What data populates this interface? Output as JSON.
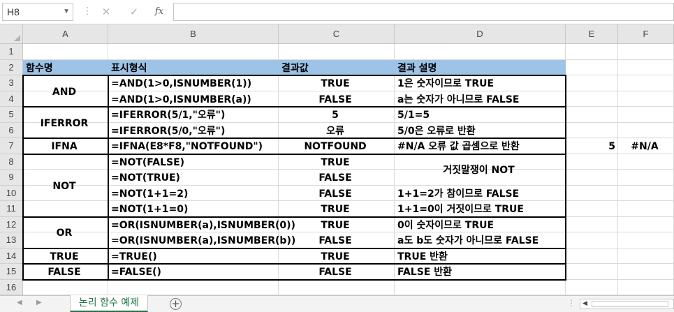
{
  "formula_bar": {
    "name_box": "H8",
    "name_box_dropdown_icon": "chevron-down-icon",
    "more_icon": "vertical-dots-icon",
    "cancel_icon": "close-icon",
    "enter_icon": "checkmark-icon",
    "function_icon": "fx-icon",
    "fx_label": "fx",
    "formula": ""
  },
  "columns": [
    "A",
    "B",
    "C",
    "D",
    "E",
    "F"
  ],
  "rows": [
    "1",
    "2",
    "3",
    "4",
    "5",
    "6",
    "7",
    "8",
    "9",
    "10",
    "11",
    "12",
    "13",
    "14",
    "15",
    "16"
  ],
  "header_row": {
    "a": "함수명",
    "b": "표시형식",
    "c": "결과값",
    "d": "결과 설명"
  },
  "table": [
    {
      "func": "AND",
      "rows": [
        {
          "formula": "=AND(1>0,ISNUMBER(1))",
          "result": "TRUE",
          "desc": "1은 숫자이므로 TRUE"
        },
        {
          "formula": "=AND(1>0,ISNUMBER(a))",
          "result": "FALSE",
          "desc": "a는 숫자가 아니므로 FALSE"
        }
      ]
    },
    {
      "func": "IFERROR",
      "rows": [
        {
          "formula": "=IFERROR(5/1,\"오류\")",
          "result": "5",
          "desc": "5/1=5"
        },
        {
          "formula": "=IFERROR(5/0,\"오류\")",
          "result": "오류",
          "desc": "5/0은 오류로 반환"
        }
      ]
    },
    {
      "func": "IFNA",
      "rows": [
        {
          "formula": "=IFNA(E8*F8,\"NOTFOUND\")",
          "result": "NOTFOUND",
          "desc": "#N/A 오류 값 곱셈으로 반환"
        }
      ]
    },
    {
      "func": "NOT",
      "merged_desc": "거짓말쟁이 NOT",
      "rows": [
        {
          "formula": "=NOT(FALSE)",
          "result": "TRUE",
          "desc": ""
        },
        {
          "formula": "=NOT(TRUE)",
          "result": "FALSE",
          "desc": ""
        },
        {
          "formula": "=NOT(1+1=2)",
          "result": "FALSE",
          "desc": "1+1=2가 참이므로 FALSE"
        },
        {
          "formula": "=NOT(1+1=0)",
          "result": "TRUE",
          "desc": "1+1=0이 거짓이므로 TRUE"
        }
      ]
    },
    {
      "func": "OR",
      "rows": [
        {
          "formula": "=OR(ISNUMBER(a),ISNUMBER(0))",
          "result": "TRUE",
          "desc": "0이 숫자이므로 TRUE"
        },
        {
          "formula": "=OR(ISNUMBER(a),ISNUMBER(b))",
          "result": "FALSE",
          "desc": "a도 b도 숫자가 아니므로 FALSE"
        }
      ]
    },
    {
      "func": "TRUE",
      "rows": [
        {
          "formula": "=TRUE()",
          "result": "TRUE",
          "desc": "TRUE 반환"
        }
      ]
    },
    {
      "func": "FALSE",
      "rows": [
        {
          "formula": "=FALSE()",
          "result": "FALSE",
          "desc": "FALSE 반환"
        }
      ]
    }
  ],
  "extra_cells": {
    "e7": "5",
    "f7": "#N/A"
  },
  "tabs": {
    "prev_icon": "triangle-left-icon",
    "next_icon": "triangle-right-icon",
    "active_sheet": "논리 함수 예제",
    "add_icon": "plus-circle-icon",
    "add_label": "+",
    "scroll_dots": "⋮",
    "scroll_left_icon": "triangle-left-icon"
  },
  "colors": {
    "header_fill": "#9dc3e6",
    "active_tab_text": "#217346",
    "grid_line": "#dadada",
    "header_bg": "#e6e6e6"
  }
}
